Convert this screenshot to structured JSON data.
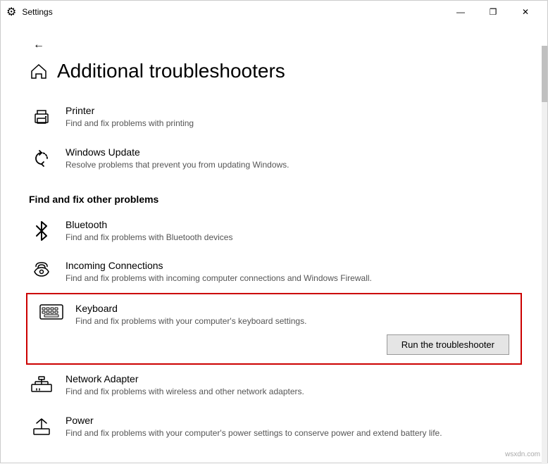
{
  "titlebar": {
    "title": "Settings",
    "minimize": "—",
    "maximize": "❐",
    "close": "✕"
  },
  "page": {
    "title": "Additional troubleshooters"
  },
  "top_items": [
    {
      "id": "printer",
      "title": "Printer",
      "desc": "Find and fix problems with printing",
      "icon": "printer"
    },
    {
      "id": "windows-update",
      "title": "Windows Update",
      "desc": "Resolve problems that prevent you from updating Windows.",
      "icon": "update"
    }
  ],
  "section_header": "Find and fix other problems",
  "other_items": [
    {
      "id": "bluetooth",
      "title": "Bluetooth",
      "desc": "Find and fix problems with Bluetooth devices",
      "icon": "bluetooth"
    },
    {
      "id": "incoming-connections",
      "title": "Incoming Connections",
      "desc": "Find and fix problems with incoming computer connections and Windows Firewall.",
      "icon": "incoming"
    },
    {
      "id": "keyboard",
      "title": "Keyboard",
      "desc": "Find and fix problems with your computer's keyboard settings.",
      "icon": "keyboard",
      "expanded": true,
      "run_label": "Run the troubleshooter"
    },
    {
      "id": "network-adapter",
      "title": "Network Adapter",
      "desc": "Find and fix problems with wireless and other network adapters.",
      "icon": "network"
    },
    {
      "id": "power",
      "title": "Power",
      "desc": "Find and fix problems with your computer's power settings to conserve power and extend battery life.",
      "icon": "power"
    }
  ]
}
